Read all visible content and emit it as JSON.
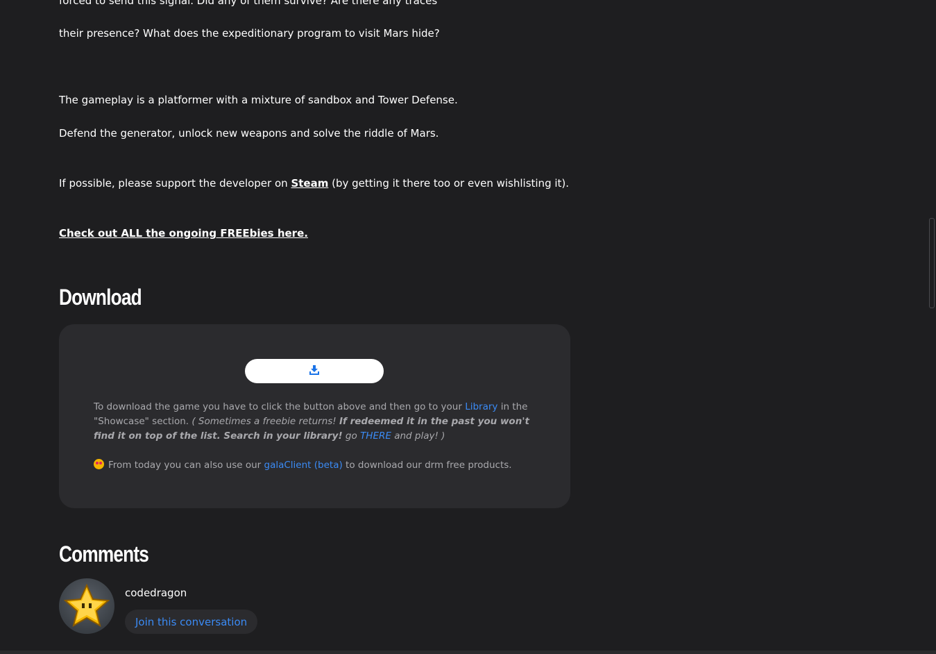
{
  "description": {
    "line1": "forced to send this signal. Did any of them survive? Are there any traces",
    "line2": "their presence? What does the expeditionary program to visit Mars hide?",
    "line3": "The gameplay is a platformer with a mixture of sandbox and Tower Defense.",
    "line4": "Defend the generator, unlock new weapons and solve the riddle of Mars.",
    "support_prefix": "If possible, please support the developer on ",
    "support_link": "Steam",
    "support_suffix": " (by getting it there too or even wishlisting it).",
    "freebies_link": "Check out ALL the ongoing FREEbies here."
  },
  "download": {
    "heading": "Download",
    "button_icon": "download-icon",
    "info_prefix": "To download the game you have to click the button above and then go to your ",
    "info_library_link": "Library",
    "info_middle": " in the \"Showcase\" section. ",
    "info_italic_start": "( Sometimes a freebie returns! ",
    "info_bold_italic": "If redeemed it in the past you won't find it on top of the list. Search in your library!",
    "info_italic_go": " go ",
    "info_there_link": "THERE",
    "info_italic_end": " and play! )",
    "client_emoji": "star-struck-emoji",
    "client_prefix": "From today you can also use our ",
    "client_link": "galaClient (beta)",
    "client_suffix": " to download our drm free products."
  },
  "comments": {
    "heading": "Comments",
    "username": "codedragon",
    "join_label": "Join this conversation"
  },
  "colors": {
    "background": "#1e1e20",
    "panel": "#2b2b2e",
    "link_blue": "#3b8bf5",
    "muted_text": "#a9a9ad"
  }
}
